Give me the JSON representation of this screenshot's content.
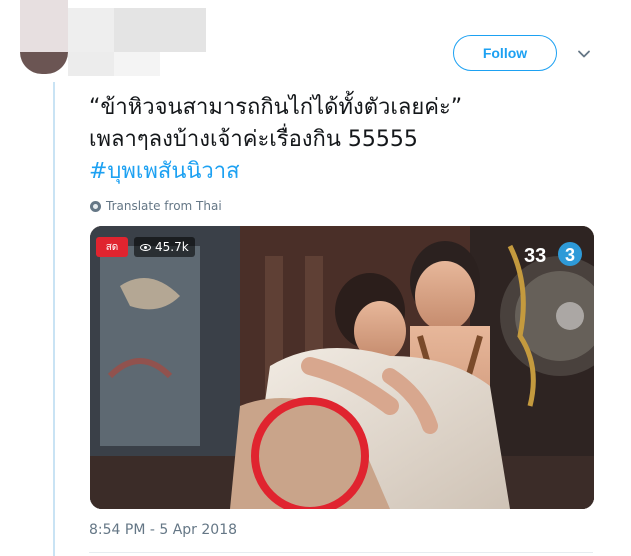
{
  "header": {
    "follow_label": "Follow"
  },
  "tweet": {
    "lines": [
      "“ข้าหิวจนสามารถกินไก่ได้ทั้งตัวเลยค่ะ”",
      "เพลาๆลงบ้างเจ้าค่ะเรื่องกิน 55555"
    ],
    "hashtag": "#บุพเพสันนิวาส",
    "translate_label": "Translate from Thai",
    "timestamp": "8:54 PM - 5 Apr 2018"
  },
  "media": {
    "live_badge": "สด",
    "view_count": "45.7k",
    "channel_logo": "33 ③",
    "highlight_color": "#e0242f"
  },
  "colors": {
    "accent": "#1da1f2",
    "muted": "#657786",
    "thread_line": "#c9e3f4"
  },
  "icons": [
    "globe-icon",
    "eye-icon",
    "chevron-down-icon",
    "channel-logo-icon"
  ]
}
